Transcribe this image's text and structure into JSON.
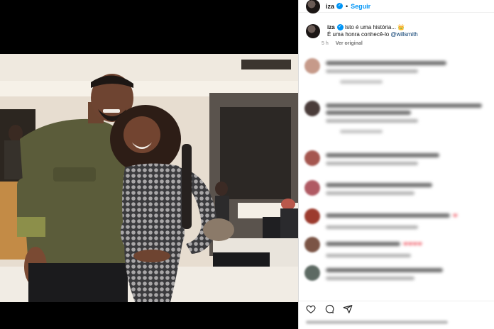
{
  "post": {
    "username": "iza",
    "follow_label": "Seguir",
    "separator": "•"
  },
  "caption": {
    "username": "iza",
    "line1": "Isto é uma história...",
    "line1_emoji": "👑",
    "line2_prefix": "É uma honra conhecê-lo ",
    "mention": "@willsmith",
    "time": "5 h",
    "see_original": "Ver original"
  },
  "comments": [
    {
      "id": 1,
      "avatar_color": "#c69a8a",
      "reply": true,
      "hearts": ""
    },
    {
      "id": 2,
      "avatar_color": "#4a3c3a",
      "reply": true,
      "hearts": ""
    },
    {
      "id": 3,
      "avatar_color": "#a5564f",
      "reply": false,
      "hearts": ""
    },
    {
      "id": 4,
      "avatar_color": "#b05a63",
      "reply": false,
      "hearts": ""
    },
    {
      "id": 5,
      "avatar_color": "#9c3b2e",
      "reply": false,
      "hearts": "❤"
    },
    {
      "id": 6,
      "avatar_color": "#7b5445",
      "reply": false,
      "hearts": "❤❤❤❤"
    },
    {
      "id": 7,
      "avatar_color": "#5d6a63",
      "reply": false,
      "hearts": ""
    }
  ],
  "icons": {
    "like": "heart-icon",
    "comment": "comment-icon",
    "share": "share-icon"
  },
  "colors": {
    "accent": "#0095f6",
    "mention": "#00376b",
    "heart": "#ed4956"
  }
}
